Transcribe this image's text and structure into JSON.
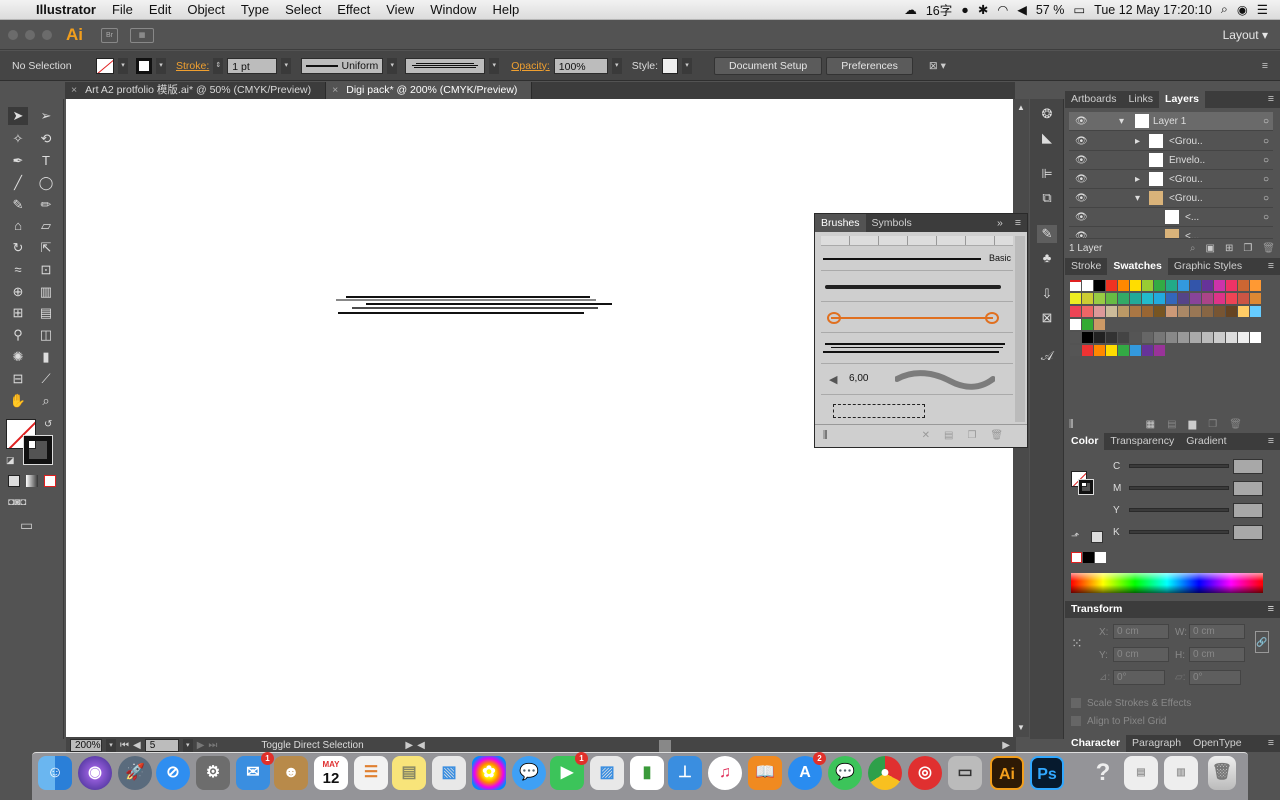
{
  "menubar": {
    "app": "Illustrator",
    "items": [
      "File",
      "Edit",
      "Object",
      "Type",
      "Select",
      "Effect",
      "View",
      "Window",
      "Help"
    ],
    "input_method": "16字",
    "battery": "57 %",
    "clock": "Tue 12 May  17:20:10"
  },
  "appbar": {
    "logo": "Ai",
    "bridge": "Br",
    "layout": "Layout"
  },
  "control": {
    "selection": "No Selection",
    "stroke_label": "Stroke:",
    "stroke_value": "1 pt",
    "profile": "Uniform",
    "opacity_label": "Opacity:",
    "opacity_value": "100%",
    "style_label": "Style:",
    "doc_setup": "Document Setup",
    "preferences": "Preferences"
  },
  "tabs": [
    {
      "label": "Art A2 protfolio 模版.ai* @ 50% (CMYK/Preview)"
    },
    {
      "label": "Digi pack* @ 200% (CMYK/Preview)"
    }
  ],
  "status": {
    "zoom": "200%",
    "artboard": "5",
    "message": "Toggle Direct Selection"
  },
  "brushes": {
    "tabs": [
      "Brushes",
      "Symbols"
    ],
    "basic": "Basic",
    "size": "6,00"
  },
  "layers": {
    "tabs": [
      "Artboards",
      "Links",
      "Layers"
    ],
    "rows": [
      "Layer 1",
      "<Grou..",
      "Envelo..",
      "<Grou..",
      "<Grou..",
      "<...",
      "<..."
    ],
    "count": "1 Layer"
  },
  "swatches": {
    "tabs": [
      "Stroke",
      "Swatches",
      "Graphic Styles"
    ]
  },
  "color": {
    "tabs": [
      "Color",
      "Transparency",
      "Gradient"
    ],
    "channels": [
      "C",
      "M",
      "Y",
      "K"
    ]
  },
  "transform": {
    "title": "Transform",
    "x": "X:",
    "y": "Y:",
    "w": "W:",
    "h": "H:",
    "x_val": "0 cm",
    "y_val": "0 cm",
    "w_val": "0 cm",
    "h_val": "0 cm",
    "rot": "0°",
    "shear": "0°",
    "scale_strokes": "Scale Strokes & Effects",
    "align_pixel": "Align to Pixel Grid"
  },
  "bottom_tabs": [
    "Character",
    "Paragraph",
    "OpenType"
  ],
  "dock": {
    "calendar_month": "MAY",
    "calendar_day": "12",
    "badge_mail": "1",
    "badge_facetime": "1",
    "badge_appstore": "2",
    "ai": "Ai",
    "ps": "Ps"
  },
  "colors": {
    "ai_orange": "#f29e1c",
    "accent_orange": "#f0a030"
  }
}
